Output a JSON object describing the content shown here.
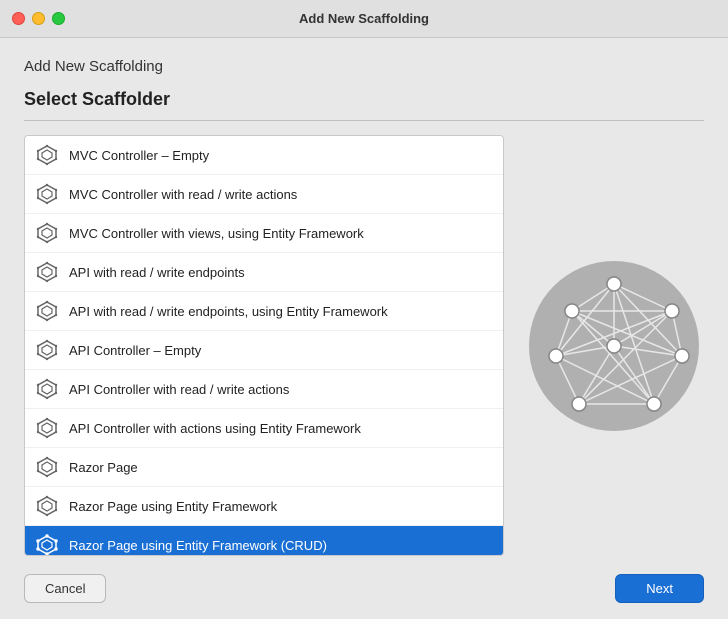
{
  "titlebar": {
    "title": "Add New Scaffolding"
  },
  "dialog": {
    "heading": "Add New Scaffolding",
    "section_title": "Select Scaffolder"
  },
  "scaffolders": [
    {
      "id": 0,
      "label": "MVC Controller – Empty",
      "selected": false
    },
    {
      "id": 1,
      "label": "MVC Controller with read / write actions",
      "selected": false
    },
    {
      "id": 2,
      "label": "MVC Controller with views, using Entity Framework",
      "selected": false
    },
    {
      "id": 3,
      "label": "API with read / write endpoints",
      "selected": false
    },
    {
      "id": 4,
      "label": "API with read / write endpoints, using Entity Framework",
      "selected": false
    },
    {
      "id": 5,
      "label": "API Controller – Empty",
      "selected": false
    },
    {
      "id": 6,
      "label": "API Controller with read / write actions",
      "selected": false
    },
    {
      "id": 7,
      "label": "API Controller with actions using Entity Framework",
      "selected": false
    },
    {
      "id": 8,
      "label": "Razor Page",
      "selected": false
    },
    {
      "id": 9,
      "label": "Razor Page using Entity Framework",
      "selected": false
    },
    {
      "id": 10,
      "label": "Razor Page using Entity Framework (CRUD)",
      "selected": true
    }
  ],
  "buttons": {
    "cancel": "Cancel",
    "next": "Next"
  }
}
